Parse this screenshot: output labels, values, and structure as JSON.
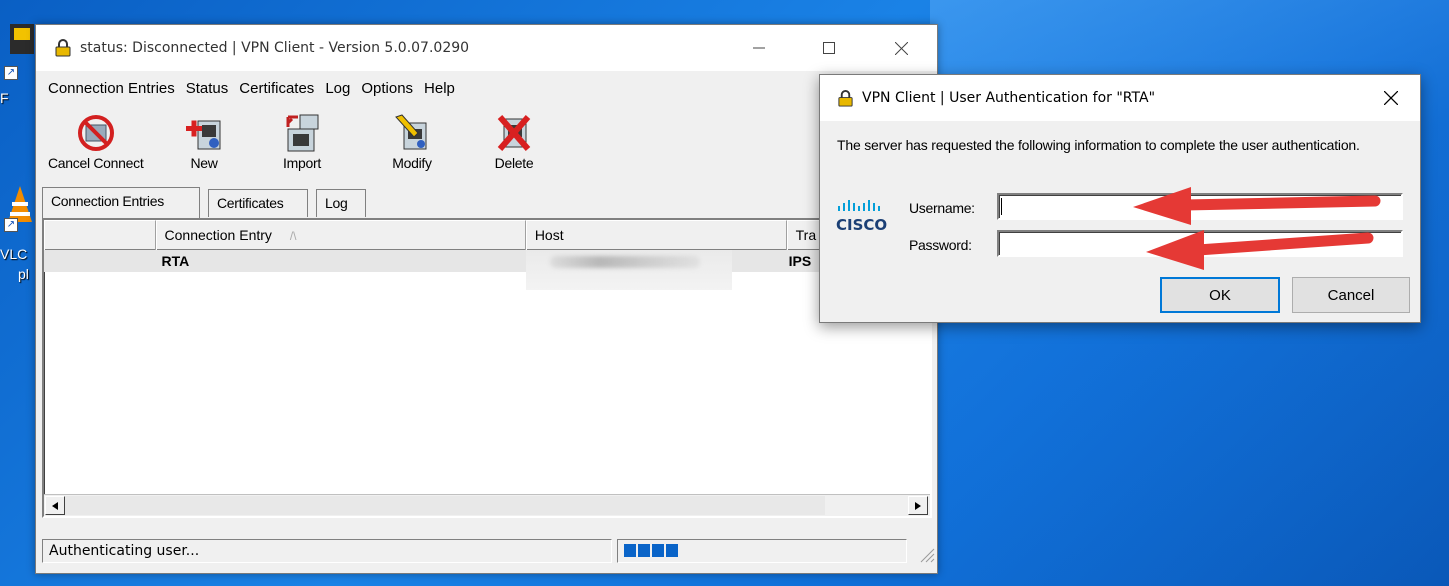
{
  "desktop": {
    "icons": [
      {
        "label": "F"
      },
      {
        "label": "VLC"
      },
      {
        "label": "pl"
      }
    ]
  },
  "main_window": {
    "title": "status: Disconnected | VPN Client - Version 5.0.07.0290",
    "menu": [
      "Connection Entries",
      "Status",
      "Certificates",
      "Log",
      "Options",
      "Help"
    ],
    "toolbar": [
      {
        "label": "Cancel Connect",
        "icon": "cancel-connect-icon"
      },
      {
        "label": "New",
        "icon": "new-entry-icon"
      },
      {
        "label": "Import",
        "icon": "import-icon"
      },
      {
        "label": "Modify",
        "icon": "modify-icon"
      },
      {
        "label": "Delete",
        "icon": "delete-icon"
      }
    ],
    "tabs": [
      "Connection Entries",
      "Certificates",
      "Log"
    ],
    "active_tab": "Connection Entries",
    "columns": [
      "",
      "Connection Entry",
      "Host",
      "Tra"
    ],
    "sort_indicator": "/\\",
    "rows": [
      {
        "entry": "RTA",
        "host": "",
        "transport": "IPS"
      }
    ],
    "status_text": "Authenticating user...",
    "progress_blocks": 4
  },
  "dialog": {
    "title": "VPN Client  |  User Authentication for \"RTA\"",
    "message": "The server has requested the following information to complete the user authentication.",
    "logo_text": "CISCO",
    "username_label": "Username:",
    "username_value": "",
    "password_label": "Password:",
    "password_value": "",
    "ok_label": "OK",
    "cancel_label": "Cancel"
  },
  "colors": {
    "desktop_blue": "#1a82e6",
    "arrow_red": "#e53935",
    "cisco_blue": "#049fd9",
    "progress_blue": "#0a64c8"
  }
}
